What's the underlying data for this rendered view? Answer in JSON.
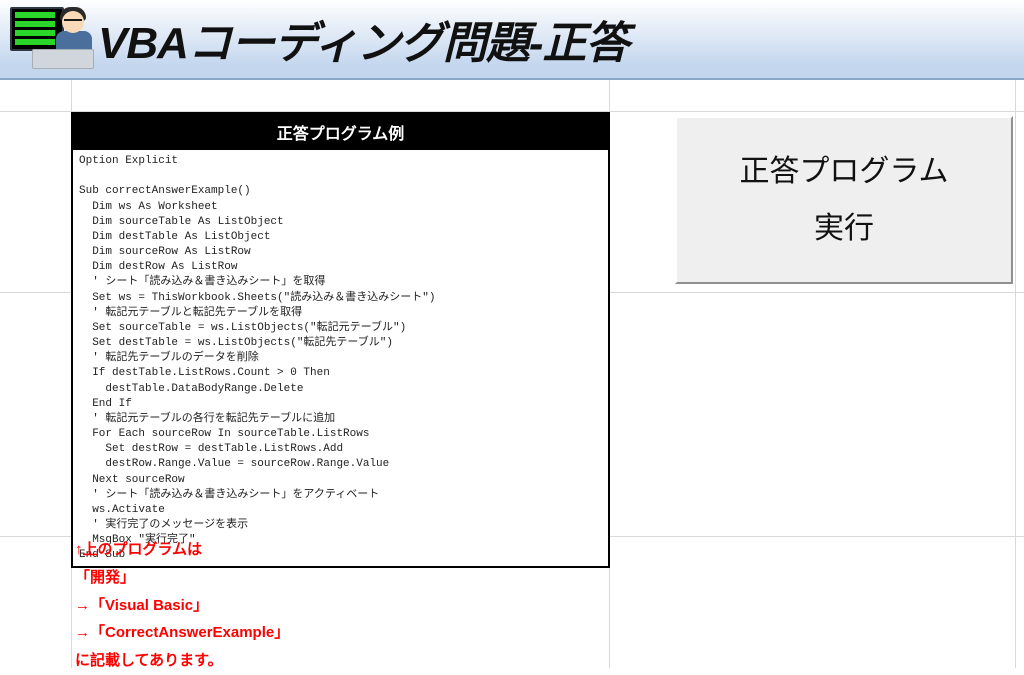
{
  "header": {
    "title": "VBAコーディング問題-正答"
  },
  "code_box": {
    "header": "正答プログラム例",
    "body": "Option Explicit\n\nSub correctAnswerExample()\n  Dim ws As Worksheet\n  Dim sourceTable As ListObject\n  Dim destTable As ListObject\n  Dim sourceRow As ListRow\n  Dim destRow As ListRow\n  ' シート「読み込み＆書き込みシート」を取得\n  Set ws = ThisWorkbook.Sheets(\"読み込み＆書き込みシート\")\n  ' 転記元テーブルと転記先テーブルを取得\n  Set sourceTable = ws.ListObjects(\"転記元テーブル\")\n  Set destTable = ws.ListObjects(\"転記先テーブル\")\n  ' 転記先テーブルのデータを削除\n  If destTable.ListRows.Count > 0 Then\n    destTable.DataBodyRange.Delete\n  End If\n  ' 転記元テーブルの各行を転記先テーブルに追加\n  For Each sourceRow In sourceTable.ListRows\n    Set destRow = destTable.ListRows.Add\n    destRow.Range.Value = sourceRow.Range.Value\n  Next sourceRow\n  ' シート「読み込み＆書き込みシート」をアクティベート\n  ws.Activate\n  ' 実行完了のメッセージを表示\n  MsgBox \"実行完了\"\nEnd Sub"
  },
  "run_button": {
    "line1": "正答プログラム",
    "line2": "実行"
  },
  "instructions": {
    "l1": "↑上のプログラムは",
    "l2": "「開発」",
    "l3": "→「Visual Basic」",
    "l4": "→「CorrectAnswerExample」",
    "l5": "に記載してあります。"
  }
}
